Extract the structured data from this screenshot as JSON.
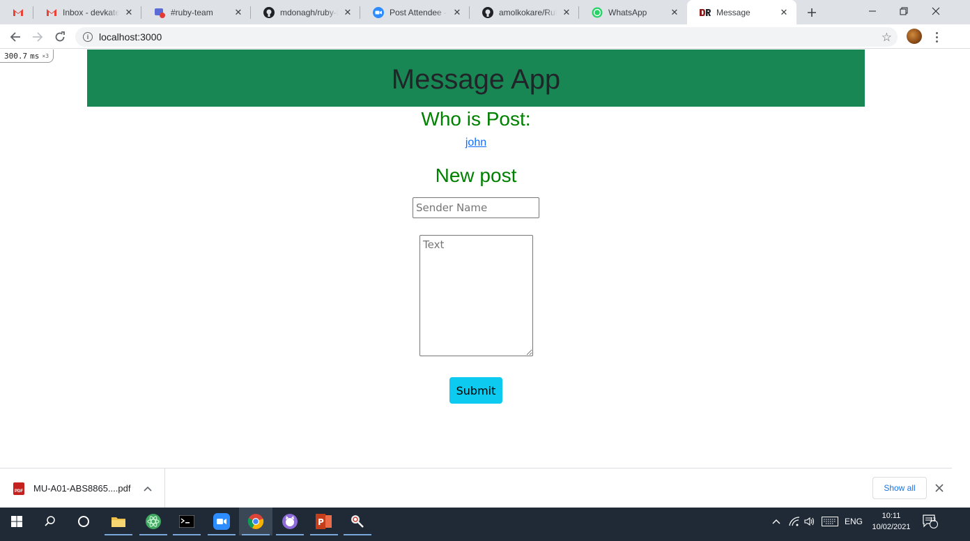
{
  "browser": {
    "tabs": [
      {
        "title": "",
        "icon": "gmail-icon"
      },
      {
        "title": "Inbox - devkatera",
        "icon": "gmail-icon"
      },
      {
        "title": "#ruby-team",
        "icon": "chat-recording-icon"
      },
      {
        "title": "mdonagh/ruby-in",
        "icon": "github-icon"
      },
      {
        "title": "Post Attendee - Z",
        "icon": "zoom-icon"
      },
      {
        "title": "amolkokare/Ruby",
        "icon": "github-icon"
      },
      {
        "title": "WhatsApp",
        "icon": "whatsapp-icon"
      },
      {
        "title": "Message",
        "icon": "app-logo-icon"
      }
    ],
    "url": "localhost:3000"
  },
  "perf_badge": {
    "value": "300.7",
    "unit": "ms",
    "count": "×3"
  },
  "page": {
    "header_title": "Message App",
    "who_heading": "Who is Post:",
    "poster_link": "john",
    "new_post_heading": "New post",
    "sender_placeholder": "Sender Name",
    "text_placeholder": "Text",
    "submit_label": "Submit"
  },
  "downloads": {
    "file_name": "MU-A01-ABS8865....pdf",
    "file_type_label": "PDF",
    "show_all_label": "Show all"
  },
  "taskbar": {
    "language": "ENG",
    "time": "10:11",
    "date": "10/02/2021",
    "notification_count": "13"
  }
}
